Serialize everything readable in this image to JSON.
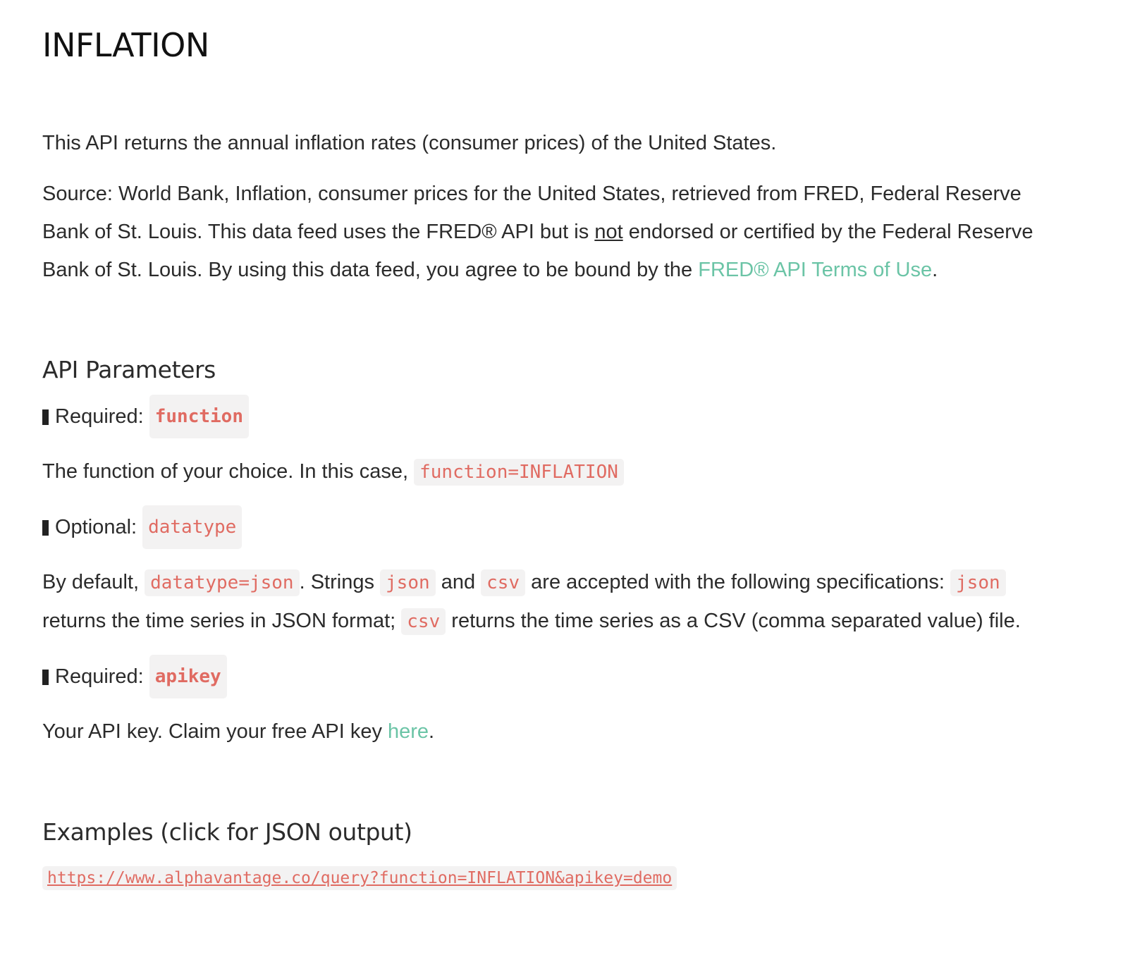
{
  "title": "INFLATION",
  "intro": "This API returns the annual inflation rates (consumer prices) of the United States.",
  "source": {
    "part1": "Source: World Bank, Inflation, consumer prices for the United States, retrieved from FRED, Federal Reserve Bank of St. Louis. This data feed uses the FRED® API but is ",
    "not": "not",
    "part2": " endorsed or certified by the Federal Reserve Bank of St. Louis. By using this data feed, you agree to be bound by the ",
    "terms_link": "FRED® API Terms of Use",
    "end": "."
  },
  "params_heading": "API Parameters",
  "params": {
    "function": {
      "label": "Required:",
      "code": "function",
      "desc_text": "The function of your choice. In this case, ",
      "desc_code": "function=INFLATION"
    },
    "datatype": {
      "label": "Optional:",
      "code": "datatype",
      "t1": "By default, ",
      "c1": "datatype=json",
      "t2": ". Strings ",
      "c2": "json",
      "t3": " and ",
      "c3": "csv",
      "t4": " are accepted with the following specifications: ",
      "c4": "json",
      "t5": " returns the time series in JSON format; ",
      "c5": "csv",
      "t6": " returns the time series as a CSV (comma separated value) file."
    },
    "apikey": {
      "label": "Required:",
      "code": "apikey",
      "desc_text": "Your API key. Claim your free API key ",
      "desc_link": "here",
      "desc_end": "."
    }
  },
  "examples_heading": "Examples (click for JSON output)",
  "example_url": "https://www.alphavantage.co/query?function=INFLATION&apikey=demo"
}
